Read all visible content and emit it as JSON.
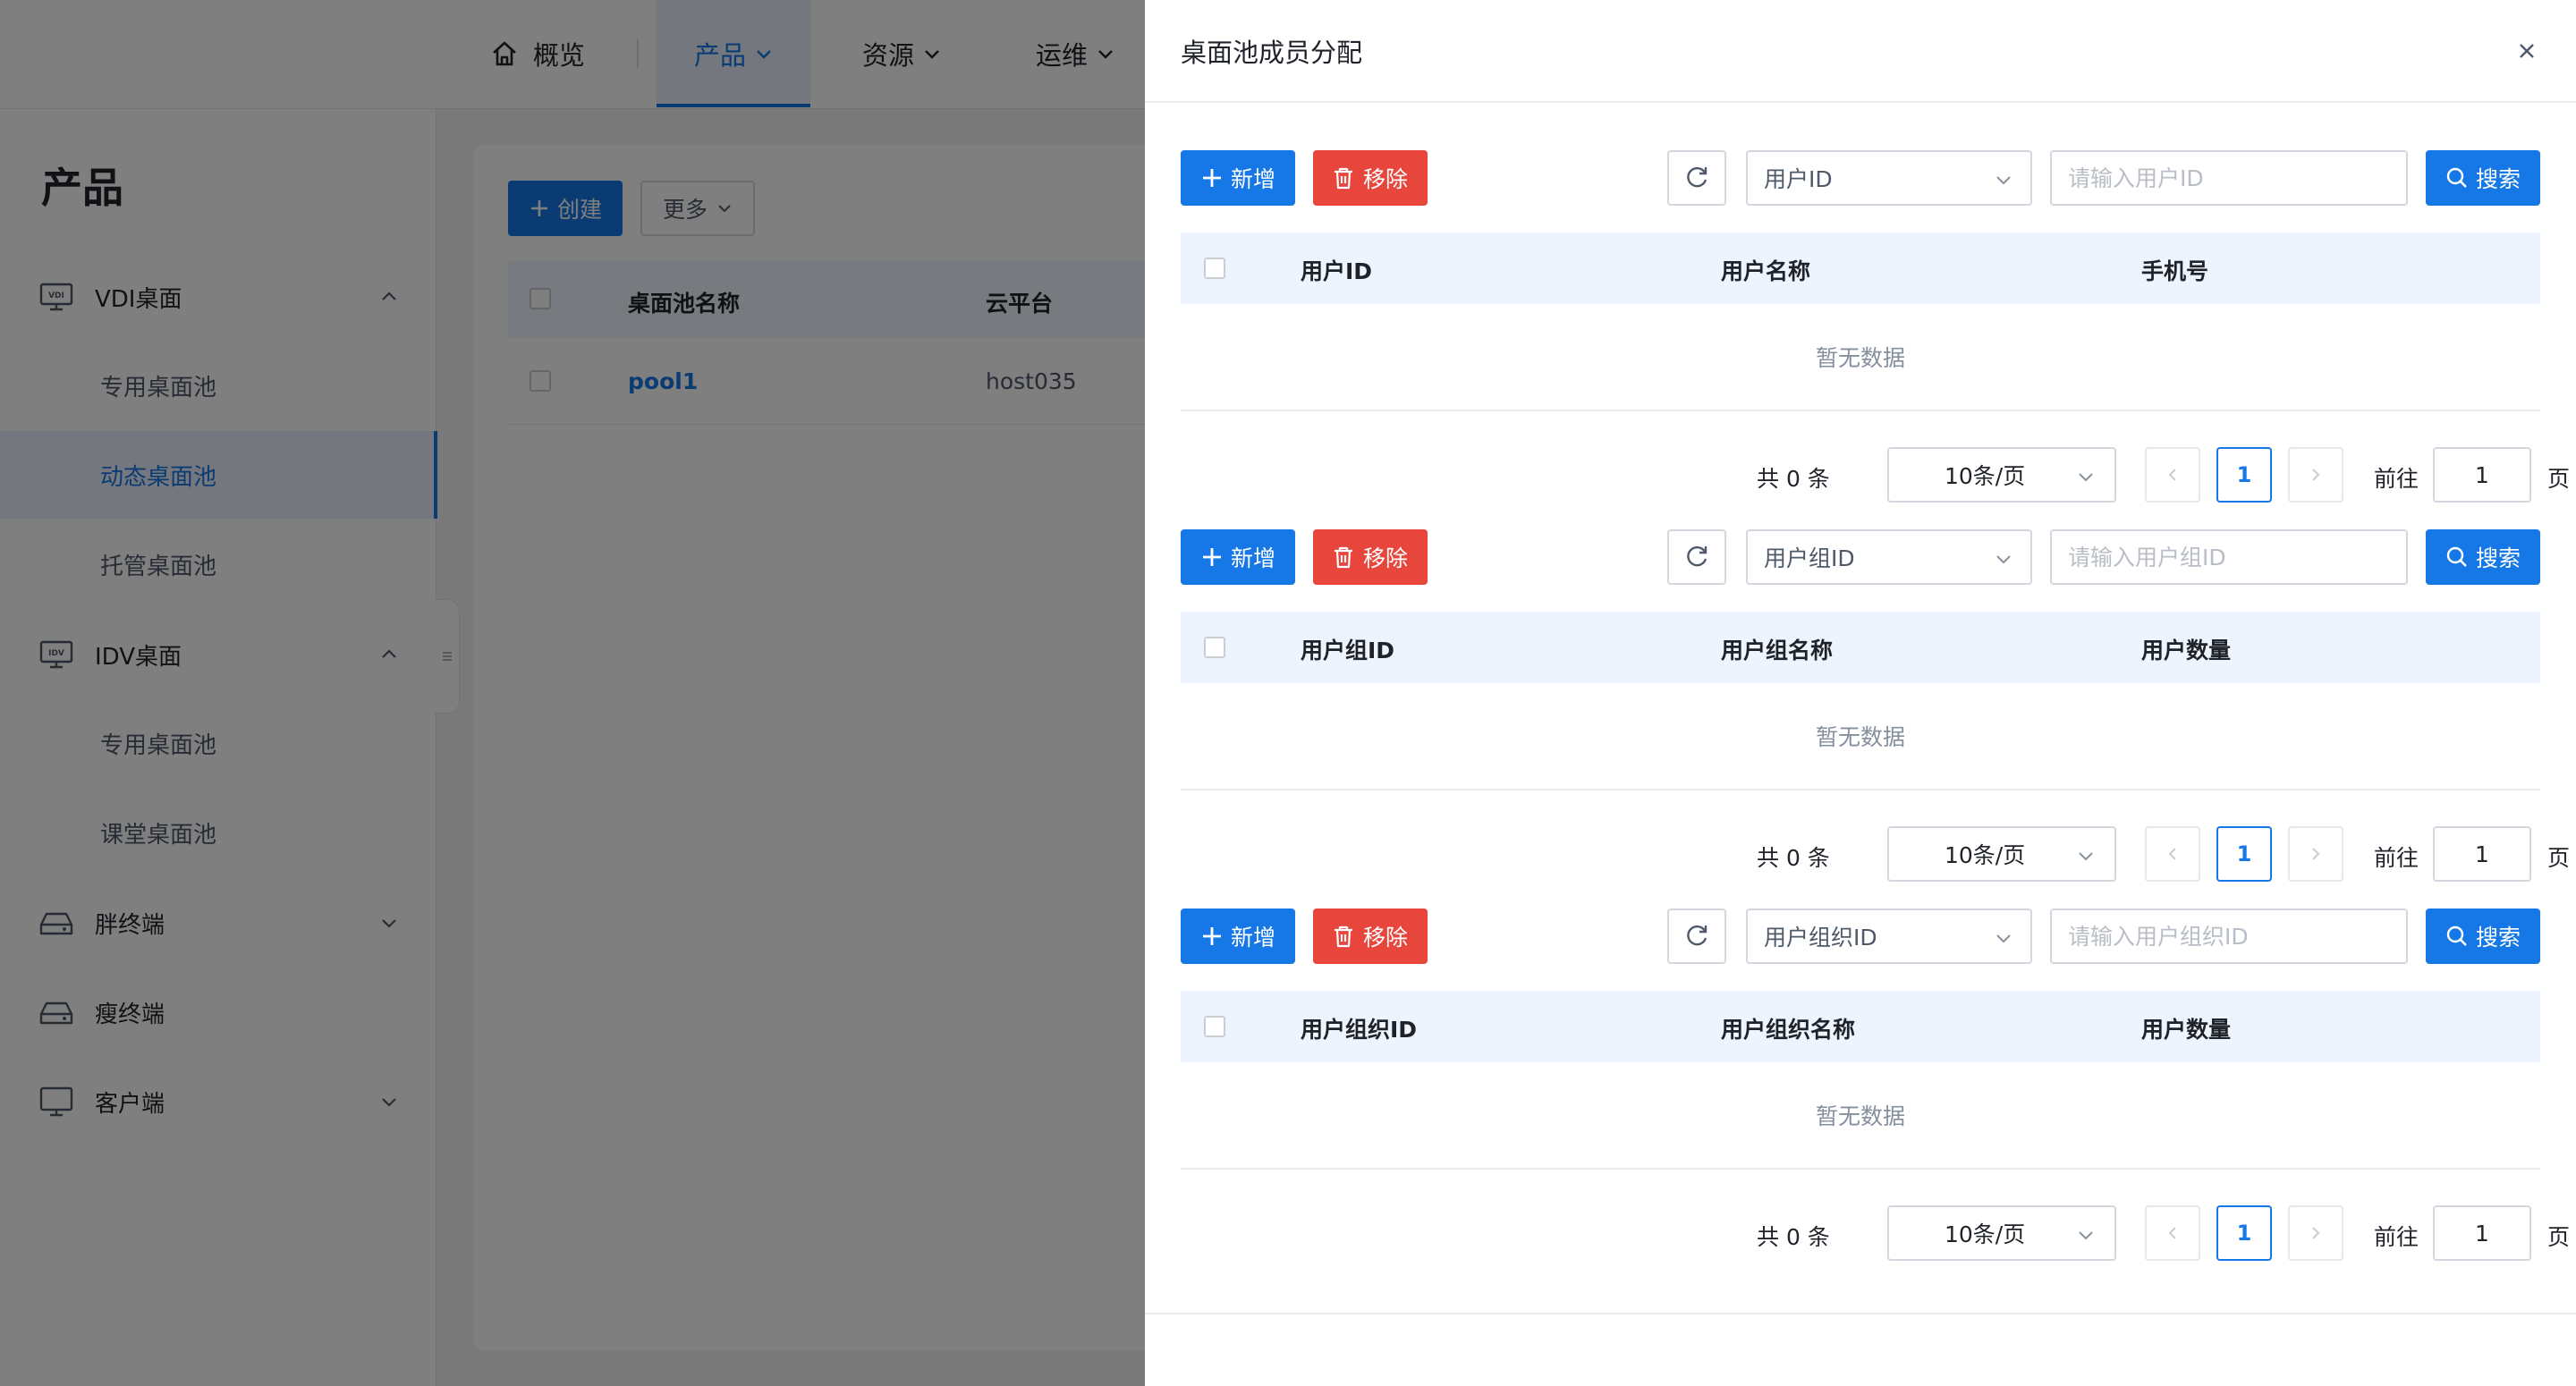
{
  "nav": {
    "home": "概览",
    "product": "产品",
    "resource": "资源",
    "ops": "运维"
  },
  "sidebar": {
    "title": "产品",
    "groups": [
      {
        "label": "VDI桌面",
        "icon": "vdi-monitor-icon",
        "sub": [
          "专用桌面池",
          "动态桌面池",
          "托管桌面池"
        ]
      },
      {
        "label": "IDV桌面",
        "icon": "idv-monitor-icon",
        "sub": [
          "专用桌面池",
          "课堂桌面池"
        ]
      },
      {
        "label": "胖终端",
        "icon": "fat-terminal-icon"
      },
      {
        "label": "瘦终端",
        "icon": "thin-terminal-icon"
      },
      {
        "label": "客户端",
        "icon": "client-monitor-icon"
      }
    ]
  },
  "content": {
    "create_label": "创建",
    "more_label": "更多",
    "columns": [
      "桌面池名称",
      "云平台"
    ],
    "rows": [
      {
        "name": "pool1",
        "platform": "host035"
      }
    ]
  },
  "drawer": {
    "title": "桌面池成员分配",
    "add_label": "新增",
    "remove_label": "移除",
    "search_label": "搜索",
    "empty_text": "暂无数据",
    "sections": [
      {
        "select_value": "用户ID",
        "placeholder": "请输入用户ID",
        "columns": [
          "用户ID",
          "用户名称",
          "手机号"
        ]
      },
      {
        "select_value": "用户组ID",
        "placeholder": "请输入用户组ID",
        "columns": [
          "用户组ID",
          "用户组名称",
          "用户数量"
        ]
      },
      {
        "select_value": "用户组织ID",
        "placeholder": "请输入用户组织ID",
        "columns": [
          "用户组织ID",
          "用户组织名称",
          "用户数量"
        ]
      }
    ],
    "pager": {
      "total_text": "共 0 条",
      "page_size": "10条/页",
      "current_page": "1",
      "goto_label": "前往",
      "goto_value": "1",
      "page_suffix": "页"
    }
  },
  "colors": {
    "primary": "#1677e6",
    "danger": "#e8453c",
    "table_header_bg": "#eef4fd"
  }
}
